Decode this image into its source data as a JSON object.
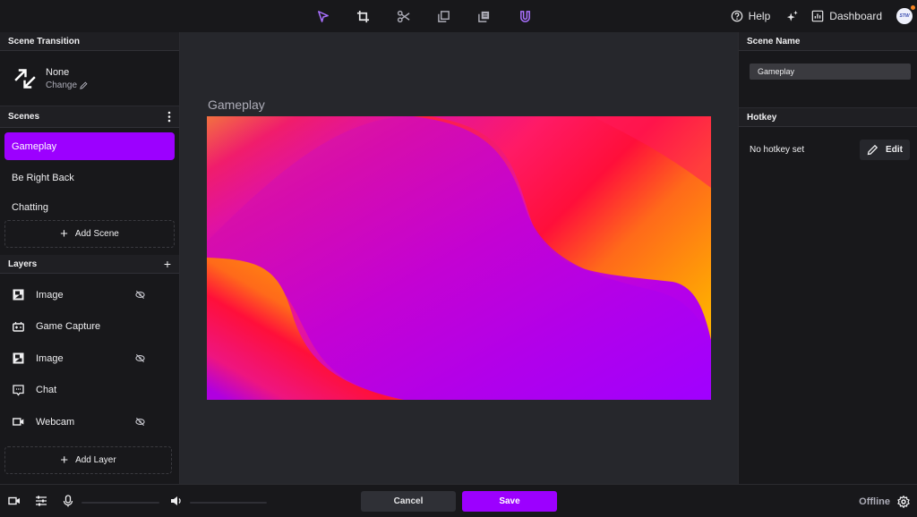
{
  "colors": {
    "accent": "#9c00ff",
    "background": "#18181b",
    "canvas_bg": "#26272c",
    "notification_dot": "#f58220"
  },
  "topbar": {
    "tools": [
      {
        "icon": "cursor-icon",
        "active": true
      },
      {
        "icon": "crop-icon",
        "active": false
      },
      {
        "icon": "scissors-icon",
        "active": false
      },
      {
        "icon": "duplicate-icon",
        "active": false
      },
      {
        "icon": "paste-icon",
        "active": false
      },
      {
        "icon": "magnet-icon",
        "active": true
      }
    ],
    "help_label": "Help",
    "dashboard_label": "Dashboard",
    "avatar_text": "STW"
  },
  "left": {
    "scene_transition_header": "Scene Transition",
    "transition_name": "None",
    "transition_change": "Change",
    "scenes_header": "Scenes",
    "scenes": [
      {
        "label": "Gameplay",
        "active": true
      },
      {
        "label": "Be Right Back",
        "active": false
      },
      {
        "label": "Chatting",
        "active": false
      }
    ],
    "add_scene_label": "Add Scene",
    "layers_header": "Layers",
    "layers": [
      {
        "label": "Image",
        "icon": "image-icon",
        "hidden": true
      },
      {
        "label": "Game Capture",
        "icon": "game-capture-icon",
        "hidden": false
      },
      {
        "label": "Image",
        "icon": "image-icon",
        "hidden": true
      },
      {
        "label": "Chat",
        "icon": "chat-icon",
        "hidden": false
      },
      {
        "label": "Webcam",
        "icon": "webcam-icon",
        "hidden": true
      }
    ],
    "add_layer_label": "Add Layer"
  },
  "center": {
    "canvas_title": "Gameplay"
  },
  "right": {
    "scene_name_header": "Scene Name",
    "scene_name_value": "Gameplay",
    "hotkey_header": "Hotkey",
    "hotkey_text": "No hotkey set",
    "edit_label": "Edit"
  },
  "bottombar": {
    "cancel_label": "Cancel",
    "save_label": "Save",
    "status": "Offline"
  }
}
